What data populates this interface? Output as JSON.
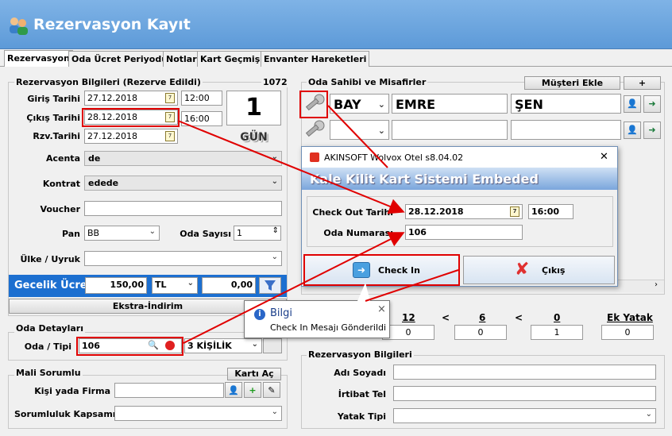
{
  "window": {
    "title": "Rezervasyon Kayıt"
  },
  "tabs": [
    "Rezervasyon",
    "Oda Ücret Periyodu",
    "Notlar",
    "Kart Geçmişi",
    "Envanter Hareketleri"
  ],
  "reservation": {
    "group_title": "Rezervasyon Bilgileri (Rezerve Edildi)",
    "number": "1072",
    "checkin_label": "Giriş Tarihi",
    "checkin_date": "27.12.2018",
    "checkin_time": "12:00",
    "checkout_label": "Çıkış Tarihi",
    "checkout_date": "28.12.2018",
    "checkout_time": "16:00",
    "rzv_label": "Rzv.Tarihi",
    "rzv_date": "27.12.2018",
    "days": "1",
    "days_unit": "GÜN",
    "agency_label": "Acenta",
    "agency": "de",
    "contract_label": "Kontrat",
    "contract": "edede",
    "voucher_label": "Voucher",
    "voucher": "",
    "pan_label": "Pan",
    "pan": "BB",
    "room_count_label": "Oda Sayısı",
    "room_count": "1",
    "country_label": "Ülke / Uyruk",
    "country": "",
    "nightly_label": "Gecelik Ücret",
    "nightly_price": "150,00",
    "currency": "TL",
    "nightly_extra": "0,00",
    "extras_button": "Ekstra-İndirim"
  },
  "room_details": {
    "group_title": "Oda Detayları",
    "room_label": "Oda / Tipi",
    "room_no": "106",
    "room_type": "3 KİŞİLİK"
  },
  "payer": {
    "group_title": "Mali Sorumlu",
    "open_card_button": "Kartı Aç",
    "person_label": "Kişi yada Firma",
    "person": "",
    "scope_label": "Sorumluluk Kapsamı",
    "scope": ""
  },
  "guests": {
    "group_title": "Oda Sahibi ve Misafirler",
    "add_customer_button": "Müşteri Ekle",
    "add_button": "+",
    "rows": [
      {
        "title": "BAY",
        "first_name": "EMRE",
        "last_name": "ŞEN"
      },
      {
        "title": "",
        "first_name": "",
        "last_name": ""
      }
    ]
  },
  "occupancy": {
    "col1": "12",
    "val1": "0",
    "col2": "6",
    "val2": "0",
    "col3": "0",
    "val3": "1",
    "lt": "<",
    "extra_bed_label": "Ek Yatak",
    "extra_bed": "0"
  },
  "reservation_info": {
    "group_title": "Rezervasyon Bilgileri",
    "name_label": "Adı Soyadı",
    "name": "",
    "contact_label": "İrtibat Tel",
    "contact": "",
    "bed_type_label": "Yatak Tipi",
    "bed_type": ""
  },
  "dialog": {
    "title": "AKINSOFT Wolvox Otel s8.04.02",
    "close": "✕",
    "banner": "Kale Kilit Kart Sistemi Embeded",
    "checkout_label": "Check Out Tarihi",
    "checkout_date": "28.12.2018",
    "checkout_time": "16:00",
    "room_label": "Oda Numarası",
    "room_no": "106",
    "checkin_button": "Check In",
    "exit_button": "Çıkış"
  },
  "tooltip": {
    "title": "Bilgi",
    "message": "Check In Mesajı Gönderildi",
    "close": "×"
  },
  "colors": {
    "title_bar": "#6aa4de",
    "highlight": "#e00000",
    "nightly_bg": "#1c6fd0"
  }
}
